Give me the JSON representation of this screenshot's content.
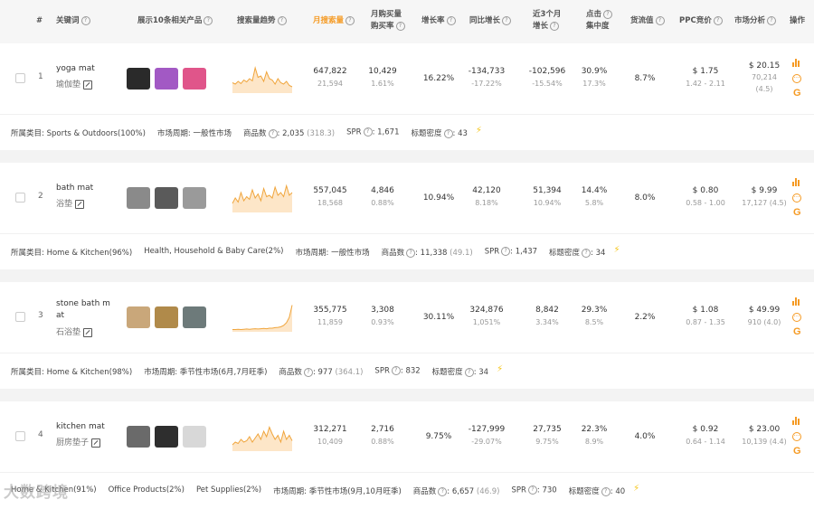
{
  "header": {
    "index": "#",
    "keyword": "关键词",
    "products": "展示10条相关产品",
    "trend": "搜索量趋势",
    "monthly_search": "月搜索量",
    "monthly_buy_l1": "月购买量",
    "monthly_buy_l2": "购买率",
    "growth": "增长率",
    "yoy": "同比增长",
    "m3_l1": "近3个月",
    "m3_l2": "增长",
    "click_l1": "点击",
    "click_l2": "集中度",
    "flow": "货流值",
    "ppc": "PPC竞价",
    "market": "市场分析",
    "action": "操作"
  },
  "rows": [
    {
      "index": "1",
      "keyword": "yoga mat",
      "keyword_zh": "瑜伽垫",
      "search": "647,822",
      "search_sub": "21,594",
      "buy": "10,429",
      "buy_sub": "1.61%",
      "growth": "16.22%",
      "yoy": "-134,733",
      "yoy_sub": "-17.22%",
      "m3": "-102,596",
      "m3_sub": "-15.54%",
      "click": "30.9%",
      "click_sub": "17.3%",
      "flow": "8.7%",
      "ppc": "$ 1.75",
      "ppc_sub": "1.42 - 2.11",
      "mkt": "$ 20.15",
      "mkt_sub": "70,214",
      "mkt_sub2": "(4.5)",
      "trend": [
        0.35,
        0.3,
        0.4,
        0.32,
        0.45,
        0.38,
        0.5,
        0.42,
        0.9,
        0.55,
        0.6,
        0.4,
        0.75,
        0.5,
        0.45,
        0.3,
        0.5,
        0.35,
        0.3,
        0.4,
        0.25,
        0.2
      ],
      "thumb_colors": [
        "#2a2a2a",
        "#a259c4",
        "#e0558a"
      ],
      "meta": [
        {
          "label": "所属类目:",
          "value": "Sports & Outdoors(100%)"
        },
        {
          "label": "市场周期:",
          "value": "一般性市场"
        },
        {
          "label": "商品数",
          "value": "2,035",
          "extra": "(318.3)"
        },
        {
          "label": "SPR",
          "value": "1,671"
        },
        {
          "label": "标题密度",
          "value": "43"
        }
      ]
    },
    {
      "index": "2",
      "keyword": "bath mat",
      "keyword_zh": "浴垫",
      "search": "557,045",
      "search_sub": "18,568",
      "buy": "4,846",
      "buy_sub": "0.88%",
      "growth": "10.94%",
      "yoy": "42,120",
      "yoy_sub": "8.18%",
      "m3": "51,394",
      "m3_sub": "10.94%",
      "click": "14.4%",
      "click_sub": "5.8%",
      "flow": "8.0%",
      "ppc": "$ 0.80",
      "ppc_sub": "0.58 - 1.00",
      "mkt": "$ 9.99",
      "mkt_sub": "17,127 (4.5)",
      "mkt_sub2": "",
      "trend": [
        0.3,
        0.5,
        0.35,
        0.7,
        0.4,
        0.55,
        0.45,
        0.8,
        0.5,
        0.65,
        0.4,
        0.85,
        0.55,
        0.6,
        0.5,
        0.9,
        0.6,
        0.7,
        0.55,
        0.95,
        0.6,
        0.7
      ],
      "thumb_colors": [
        "#8a8a8a",
        "#5a5a5a",
        "#9a9a9a"
      ],
      "meta": [
        {
          "label": "所属类目:",
          "value": "Home & Kitchen(96%)"
        },
        {
          "label": "",
          "value": "Health, Household & Baby Care(2%)"
        },
        {
          "label": "市场周期:",
          "value": "一般性市场"
        },
        {
          "label": "商品数",
          "value": "11,338",
          "extra": "(49.1)"
        },
        {
          "label": "SPR",
          "value": "1,437"
        },
        {
          "label": "标题密度",
          "value": "34"
        }
      ]
    },
    {
      "index": "3",
      "keyword": "stone bath m",
      "keyword2": "at",
      "keyword_zh": "石浴垫",
      "search": "355,775",
      "search_sub": "11,859",
      "buy": "3,308",
      "buy_sub": "0.93%",
      "growth": "30.11%",
      "yoy": "324,876",
      "yoy_sub": "1,051%",
      "m3": "8,842",
      "m3_sub": "3.34%",
      "click": "29.3%",
      "click_sub": "8.5%",
      "flow": "2.2%",
      "ppc": "$ 1.08",
      "ppc_sub": "0.87 - 1.35",
      "mkt": "$ 49.99",
      "mkt_sub": "910 (4.0)",
      "mkt_sub2": "",
      "trend": [
        0.05,
        0.05,
        0.06,
        0.05,
        0.06,
        0.07,
        0.06,
        0.07,
        0.08,
        0.07,
        0.08,
        0.09,
        0.08,
        0.1,
        0.1,
        0.12,
        0.13,
        0.15,
        0.2,
        0.3,
        0.5,
        0.95
      ],
      "thumb_colors": [
        "#c9a77a",
        "#b08a4a",
        "#6d7a7a"
      ],
      "meta": [
        {
          "label": "所属类目:",
          "value": "Home & Kitchen(98%)"
        },
        {
          "label": "市场周期:",
          "value": "季节性市场(6月,7月旺季)"
        },
        {
          "label": "商品数",
          "value": "977",
          "extra": "(364.1)"
        },
        {
          "label": "SPR",
          "value": "832"
        },
        {
          "label": "标题密度",
          "value": "34"
        }
      ]
    },
    {
      "index": "4",
      "keyword": "kitchen mat",
      "keyword_zh": "厨房垫子",
      "search": "312,271",
      "search_sub": "10,409",
      "buy": "2,716",
      "buy_sub": "0.88%",
      "growth": "9.75%",
      "yoy": "-127,999",
      "yoy_sub": "-29.07%",
      "m3": "27,735",
      "m3_sub": "9.75%",
      "click": "22.3%",
      "click_sub": "8.9%",
      "flow": "4.0%",
      "ppc": "$ 0.92",
      "ppc_sub": "0.64 - 1.14",
      "mkt": "$ 23.00",
      "mkt_sub": "10,139 (4.4)",
      "mkt_sub2": "",
      "trend": [
        0.2,
        0.3,
        0.25,
        0.4,
        0.3,
        0.35,
        0.5,
        0.3,
        0.45,
        0.6,
        0.4,
        0.7,
        0.5,
        0.85,
        0.6,
        0.4,
        0.55,
        0.3,
        0.7,
        0.4,
        0.55,
        0.35
      ],
      "thumb_colors": [
        "#6a6a6a",
        "#2e2e2e",
        "#d8d8d8"
      ],
      "meta": [
        {
          "label": "",
          "value": "Home & Kitchen(91%)"
        },
        {
          "label": "",
          "value": "Office Products(2%)"
        },
        {
          "label": "",
          "value": "Pet Supplies(2%)"
        },
        {
          "label": "市场周期:",
          "value": "季节性市场(9月,10月旺季)"
        },
        {
          "label": "商品数",
          "value": "6,657",
          "extra": "(46.9)"
        },
        {
          "label": "SPR",
          "value": "730"
        },
        {
          "label": "标题密度",
          "value": "40"
        }
      ]
    }
  ],
  "watermark": "大数跨境",
  "colors": {
    "accent": "#f59a23",
    "trend_line": "#f0a53c",
    "trend_fill": "#fde6c8"
  }
}
